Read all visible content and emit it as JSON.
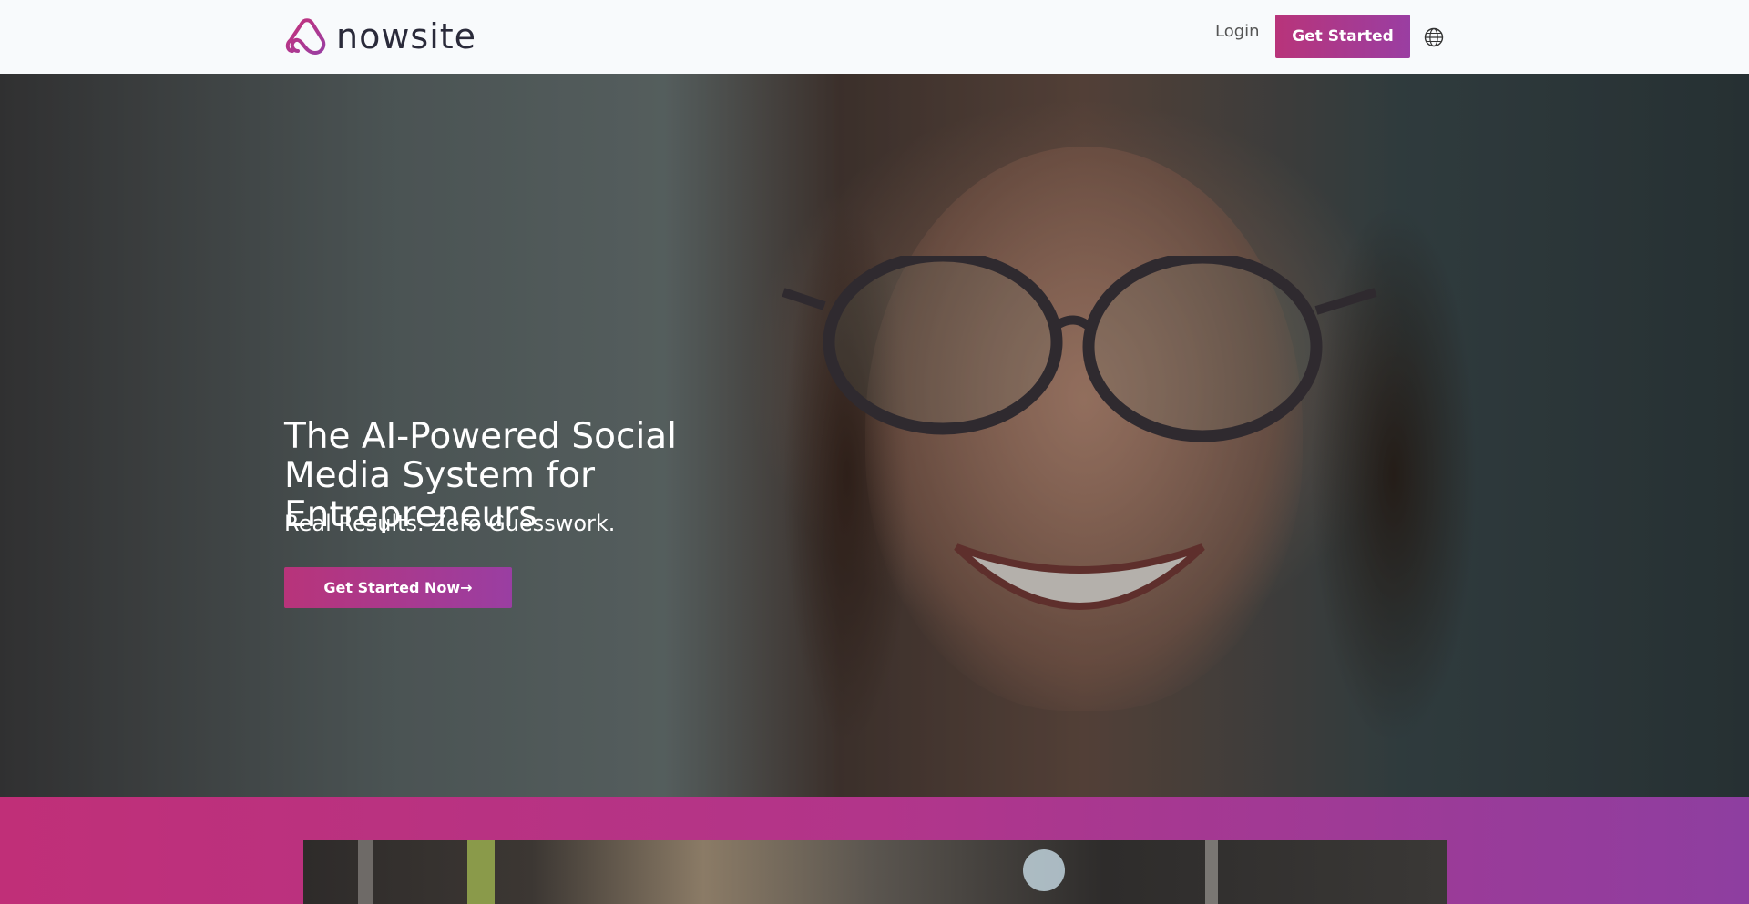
{
  "header": {
    "brand": "nowsite",
    "login_label": "Login",
    "cta_label": "Get Started",
    "language_icon": "globe-icon",
    "brand_color": "#b8347a"
  },
  "hero": {
    "title": "The AI-Powered Social Media System for Entrepreneurs",
    "subtitle": "Real Results. Zero Guesswork.",
    "cta_label": "Get Started Now→"
  },
  "colors": {
    "accent_start": "#b8347a",
    "accent_end": "#9a3ea2",
    "band_start": "#c02f78",
    "band_end": "#8e3ea0"
  }
}
